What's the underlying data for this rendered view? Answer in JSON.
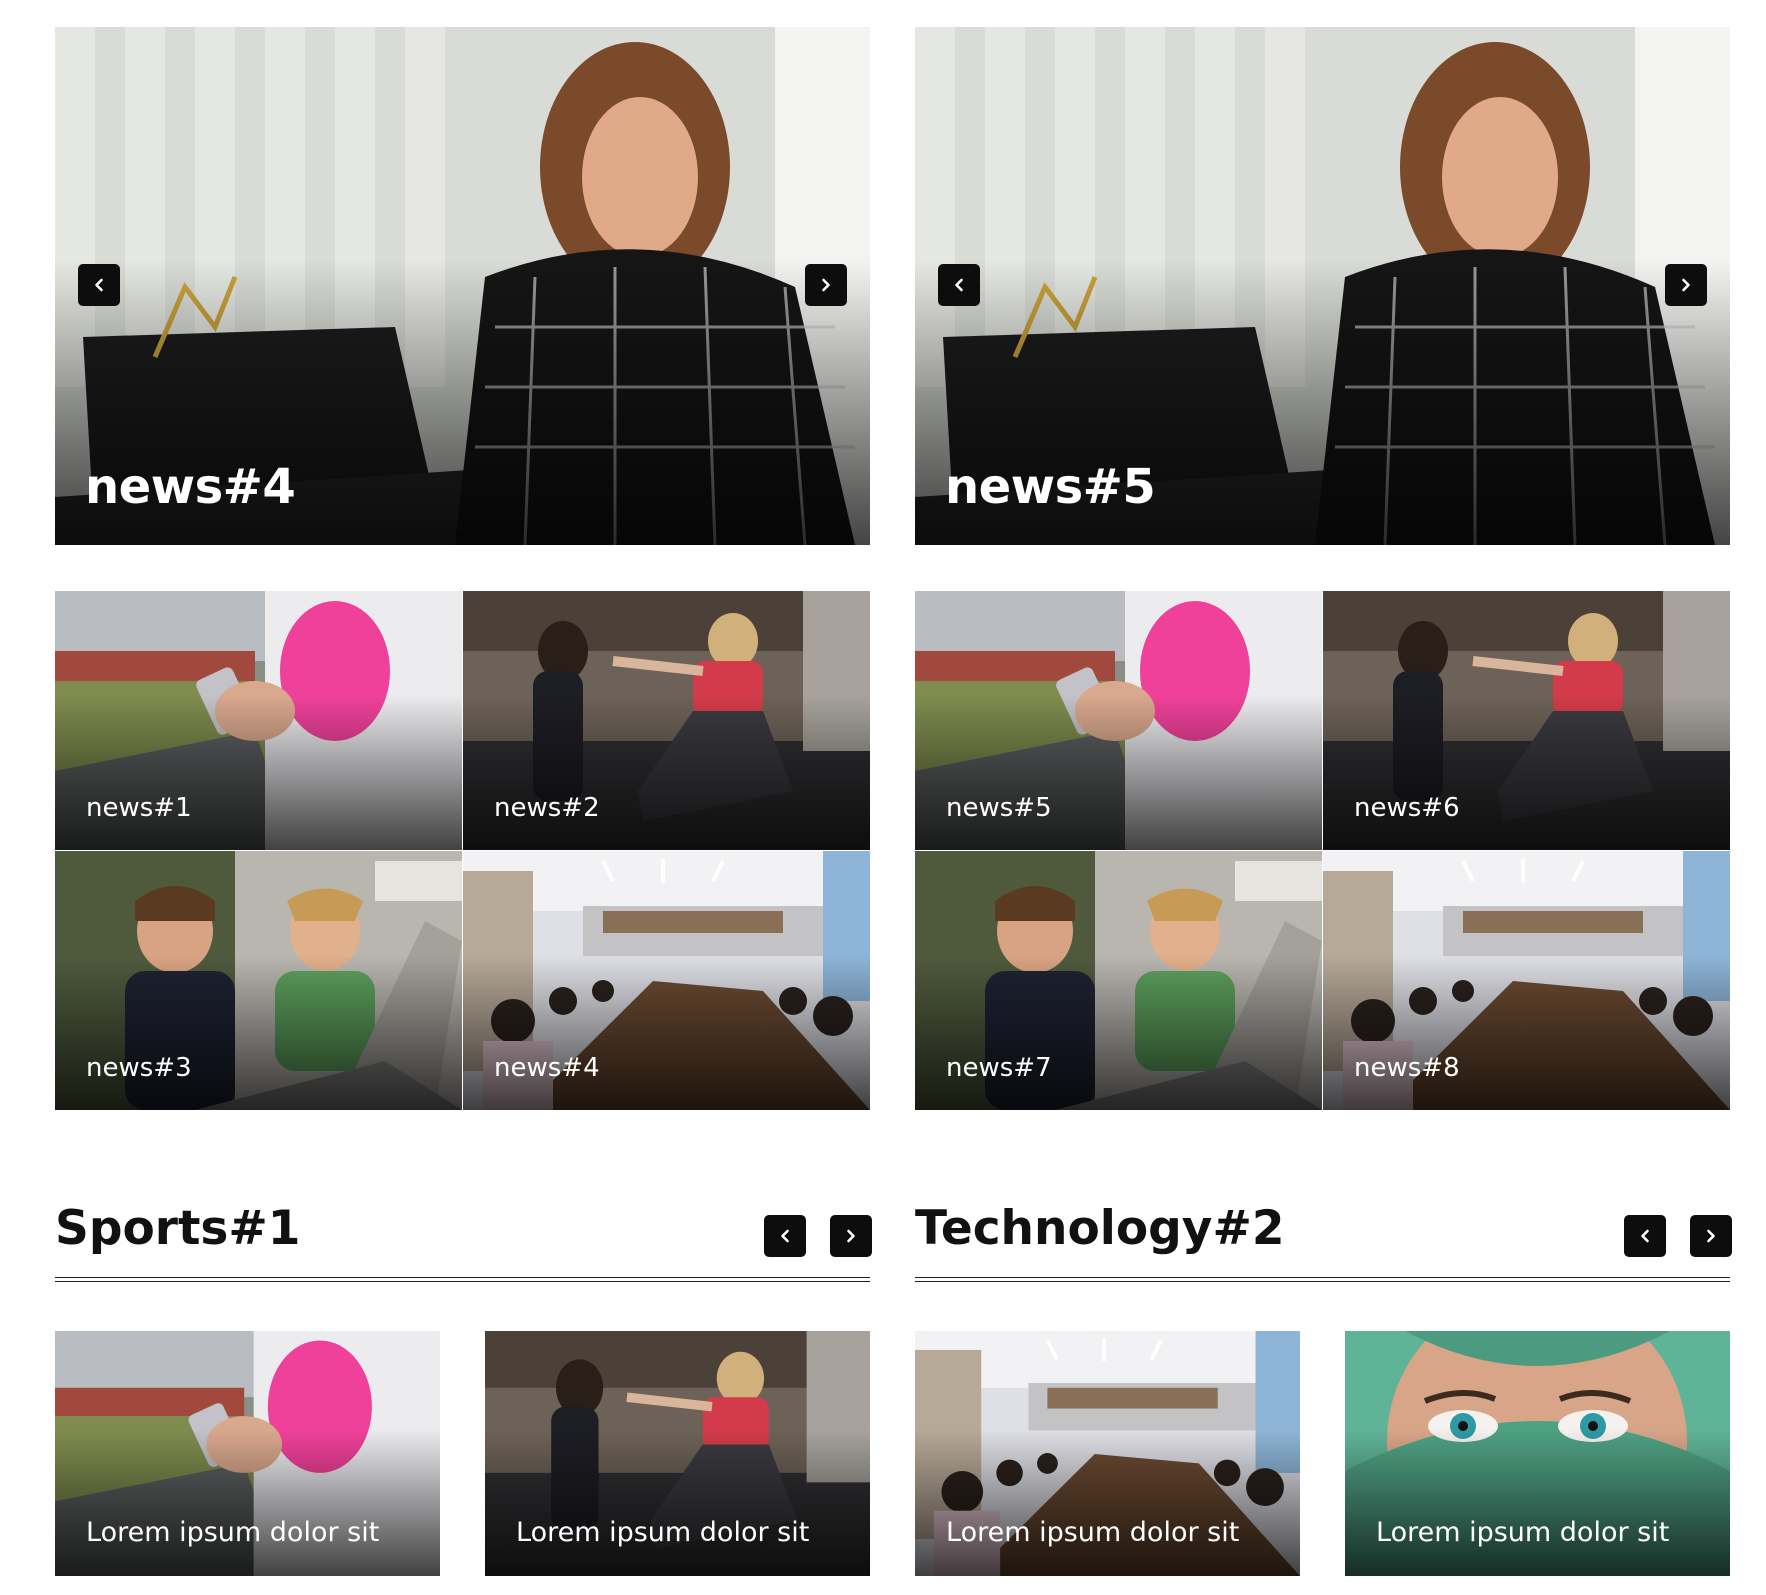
{
  "columns": [
    {
      "hero": {
        "title": "news#4"
      },
      "grid": [
        {
          "title": "news#1"
        },
        {
          "title": "news#2"
        },
        {
          "title": "news#3"
        },
        {
          "title": "news#4"
        }
      ],
      "section": {
        "title": "Sports#1",
        "cards": [
          {
            "title": "Lorem ipsum dolor sit"
          },
          {
            "title": "Lorem ipsum dolor sit"
          }
        ]
      }
    },
    {
      "hero": {
        "title": "news#5"
      },
      "grid": [
        {
          "title": "news#5"
        },
        {
          "title": "news#6"
        },
        {
          "title": "news#7"
        },
        {
          "title": "news#8"
        }
      ],
      "section": {
        "title": "Technology#2",
        "cards": [
          {
            "title": "Lorem ipsum dolor sit"
          },
          {
            "title": "Lorem ipsum dolor sit"
          }
        ]
      }
    }
  ],
  "icons": {
    "prev": "chevron-left-icon",
    "next": "chevron-right-icon"
  },
  "colors": {
    "button_bg": "#0d0d0d",
    "text_dark": "#111111",
    "overlay_text": "#ffffff"
  }
}
